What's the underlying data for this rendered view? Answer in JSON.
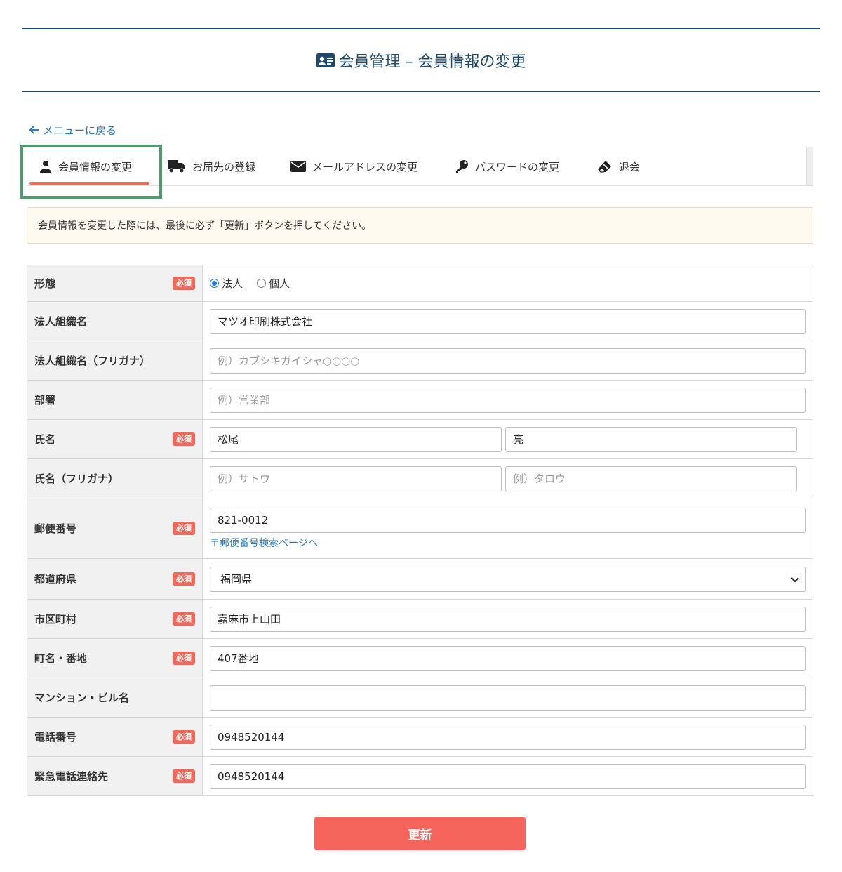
{
  "header": {
    "title": "会員管理 – 会員情報の変更",
    "icon": "id-card-icon"
  },
  "back_link": {
    "label": "メニューに戻る",
    "icon": "arrow-left-icon"
  },
  "tabs": [
    {
      "label": "会員情報の変更",
      "icon": "user-icon",
      "active": true
    },
    {
      "label": "お届先の登録",
      "icon": "truck-icon",
      "active": false
    },
    {
      "label": "メールアドレスの変更",
      "icon": "envelope-icon",
      "active": false
    },
    {
      "label": "パスワードの変更",
      "icon": "key-icon",
      "active": false
    },
    {
      "label": "退会",
      "icon": "eraser-icon",
      "active": false
    }
  ],
  "notice": "会員情報を変更した際には、最後に必ず「更新」ボタンを押してください。",
  "required_badge": "必須",
  "form": {
    "entity_type": {
      "label": "形態",
      "options": [
        "法人",
        "個人"
      ],
      "selected": "法人"
    },
    "company_name": {
      "label": "法人組織名",
      "value": "マツオ印刷株式会社"
    },
    "company_kana": {
      "label": "法人組織名（フリガナ）",
      "placeholder": "例）カブシキガイシャ○○○○",
      "value": ""
    },
    "department": {
      "label": "部署",
      "placeholder": "例）営業部",
      "value": ""
    },
    "name": {
      "label": "氏名",
      "last_value": "松尾",
      "first_value": "亮"
    },
    "name_kana": {
      "label": "氏名（フリガナ）",
      "last_placeholder": "例）サトウ",
      "first_placeholder": "例）タロウ"
    },
    "postal_code": {
      "label": "郵便番号",
      "value": "821-0012",
      "link": "〒郵便番号検索ページへ"
    },
    "prefecture": {
      "label": "都道府県",
      "value": "福岡県"
    },
    "city": {
      "label": "市区町村",
      "value": "嘉麻市上山田"
    },
    "street": {
      "label": "町名・番地",
      "value": "407番地"
    },
    "building": {
      "label": "マンション・ビル名",
      "value": ""
    },
    "phone": {
      "label": "電話番号",
      "value": "0948520144"
    },
    "emergency_phone": {
      "label": "緊急電話連絡先",
      "value": "0948520144"
    }
  },
  "submit_label": "更新",
  "colors": {
    "primary": "#1d4a6b",
    "accent": "#f06a5c",
    "link": "#2a78b8",
    "active_frame": "#4d9a6d"
  }
}
